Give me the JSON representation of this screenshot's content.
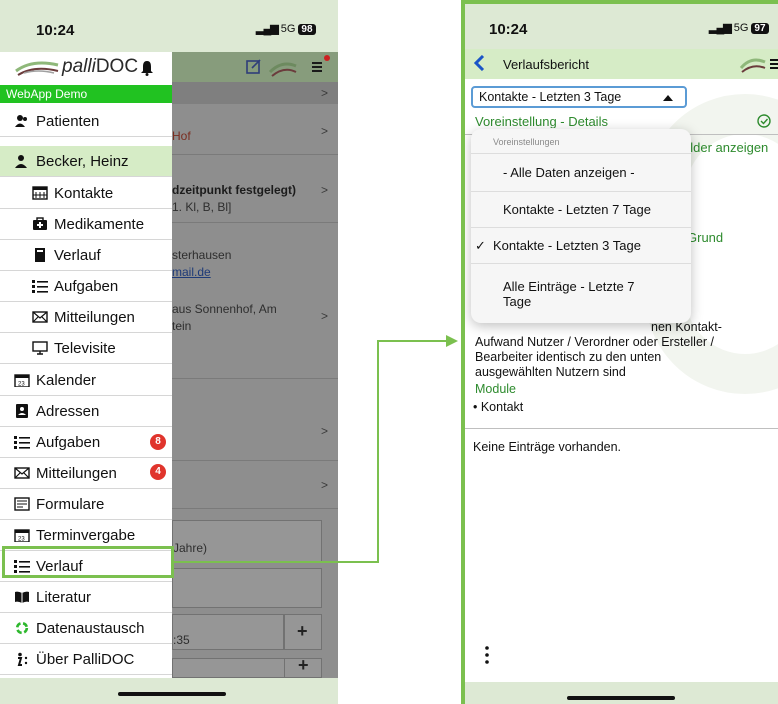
{
  "colors": {
    "accent_green": "#21c221",
    "highlight_green": "#7bc04f",
    "header_green": "#d6ecc6",
    "link_green": "#2e8b2e",
    "badge_red": "#e0342c",
    "select_blue": "#5b9bd5"
  },
  "left_phone": {
    "status": {
      "time": "10:24",
      "network": "5G",
      "battery": "98"
    },
    "drawer": {
      "app_name": "palliDOC",
      "app_name_prefix": "palli",
      "app_name_suffix": "DOC",
      "demo_label": "WebApp Demo",
      "items": [
        {
          "label": "Patienten",
          "icon": "patients-icon"
        },
        {
          "label": "Becker, Heinz",
          "icon": "person-icon"
        },
        {
          "label": "Kontakte",
          "icon": "calendar-grid-icon"
        },
        {
          "label": "Medikamente",
          "icon": "medkit-icon"
        },
        {
          "label": "Verlauf",
          "icon": "document-icon"
        },
        {
          "label": "Aufgaben",
          "icon": "list-icon"
        },
        {
          "label": "Mitteilungen",
          "icon": "envelope-icon"
        },
        {
          "label": "Televisite",
          "icon": "monitor-icon"
        },
        {
          "label": "Kalender",
          "icon": "calendar-icon"
        },
        {
          "label": "Adressen",
          "icon": "address-book-icon"
        },
        {
          "label": "Aufgaben",
          "icon": "list-icon",
          "badge": "8"
        },
        {
          "label": "Mitteilungen",
          "icon": "envelope-icon",
          "badge": "4"
        },
        {
          "label": "Formulare",
          "icon": "form-icon"
        },
        {
          "label": "Terminvergabe",
          "icon": "calendar-icon"
        },
        {
          "label": "Verlauf",
          "icon": "list-icon"
        },
        {
          "label": "Literatur",
          "icon": "book-icon"
        },
        {
          "label": "Datenaustausch",
          "icon": "sync-icon"
        },
        {
          "label": "Über PalliDOC",
          "icon": "info-icon"
        }
      ]
    },
    "background_app": {
      "partial_texts": [
        "Hof",
        "dzeitpunkt festgelegt)",
        "1. Kl, B, Bl]",
        "sterhausen",
        "mail.de",
        "aus Sonnenhof, Am",
        "tein",
        "Jahre)",
        ":35"
      ]
    }
  },
  "right_phone": {
    "status": {
      "time": "10:24",
      "network": "5G",
      "battery": "97"
    },
    "header_title": "Verlaufsbericht",
    "filter_select": {
      "selected": "Kontakte - Letzten 3 Tage"
    },
    "presets_link": "Voreinstellung - Details",
    "felder_text": "elder anzeigen",
    "grund_text": "Grund",
    "dropdown": {
      "header": "Voreinstellungen",
      "options": [
        {
          "label": "- Alle Daten anzeigen -",
          "checked": false
        },
        {
          "label": "Kontakte - Letzten 7 Tage",
          "checked": false
        },
        {
          "label": "Kontakte - Letzten 3 Tage",
          "checked": true
        },
        {
          "label": "Alle Einträge - Letzte 7",
          "label_line2": "Tage",
          "checked": false
        }
      ]
    },
    "description_fragment": "nen Kontakt-",
    "description_lines": [
      "Aufwand Nutzer / Verordner oder Ersteller /",
      "Bearbeiter identisch zu den unten",
      "ausgewählten Nutzern sind"
    ],
    "module_title": "Module",
    "module_item": "• Kontakt",
    "no_entries": "Keine Einträge vorhanden.",
    "more_icon": "vertical-dots-icon"
  }
}
